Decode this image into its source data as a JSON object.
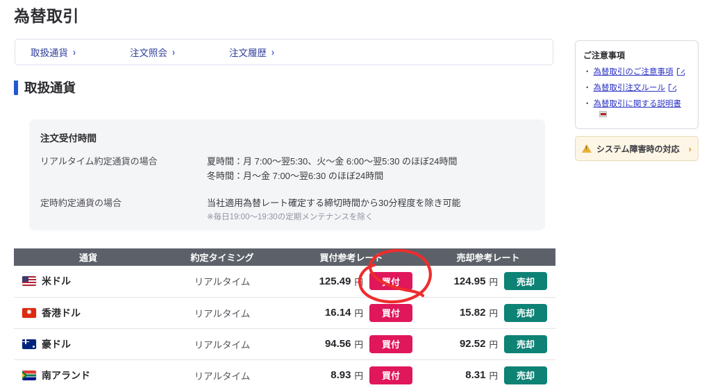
{
  "page": {
    "title": "為替取引"
  },
  "nav": {
    "items": [
      {
        "label": "取扱通貨",
        "chevron": "›"
      },
      {
        "label": "注文照会",
        "chevron": "›"
      },
      {
        "label": "注文履歴",
        "chevron": "›"
      }
    ]
  },
  "section": {
    "heading": "取扱通貨"
  },
  "info_panel": {
    "title": "注文受付時間",
    "rows": [
      {
        "key": "リアルタイム約定通貨の場合",
        "line1": "夏時間：月 7:00〜翌5:30、火〜金 6:00〜翌5:30 のほぼ24時間",
        "line2": "冬時間：月〜金 7:00〜翌6:30 のほぼ24時間",
        "note": ""
      },
      {
        "key": "定時約定通貨の場合",
        "line1": "当社適用為替レート確定する締切時間から30分程度を除き可能",
        "line2": "",
        "note": "※毎日19:00〜19:30の定期メンテナンスを除く"
      }
    ]
  },
  "table": {
    "headers": {
      "currency": "通貨",
      "timing": "約定タイミング",
      "buy_rate": "買付参考レート",
      "sell_rate": "売却参考レート"
    },
    "yen_unit": "円",
    "buy_label": "買付",
    "sell_label": "売却",
    "rows": [
      {
        "flag": "flag-us",
        "flag_name": "us-flag-icon",
        "currency": "米ドル",
        "timing": "リアルタイム",
        "buy_rate": "125.49",
        "sell_rate": "124.95"
      },
      {
        "flag": "flag-hk",
        "flag_name": "hong-kong-flag-icon",
        "currency": "香港ドル",
        "timing": "リアルタイム",
        "buy_rate": "16.14",
        "sell_rate": "15.82"
      },
      {
        "flag": "flag-au",
        "flag_name": "australia-flag-icon",
        "currency": "豪ドル",
        "timing": "リアルタイム",
        "buy_rate": "94.56",
        "sell_rate": "92.52"
      },
      {
        "flag": "flag-za",
        "flag_name": "south-africa-flag-icon",
        "currency": "南アランド",
        "timing": "リアルタイム",
        "buy_rate": "8.93",
        "sell_rate": "8.31"
      }
    ]
  },
  "sidebar": {
    "notice_title": "ご注意事項",
    "bullet": "・",
    "links": [
      {
        "label": "為替取引のご注意事項",
        "icon": "external-link-icon"
      },
      {
        "label": "為替取引注文ルール",
        "icon": "external-link-icon"
      },
      {
        "label": "為替取引に関する説明書",
        "icon": "pdf-icon"
      }
    ],
    "system_button": {
      "label": "システム障害時の対応",
      "chevron": "›",
      "icon": "warning-triangle-icon"
    }
  },
  "colors": {
    "accent_blue": "#2457d6",
    "link_blue": "#2d35c4",
    "buy_pink": "#e0175b",
    "sell_teal": "#0d8275",
    "table_header_gray": "#5c6169",
    "panel_gray": "#f4f5f7",
    "annotation_red": "#ee2d2d",
    "warning_bg": "#fdf6e6"
  },
  "annotation": {
    "shape": "hand-drawn-red-ellipse",
    "target": "buy-button-row-0"
  }
}
